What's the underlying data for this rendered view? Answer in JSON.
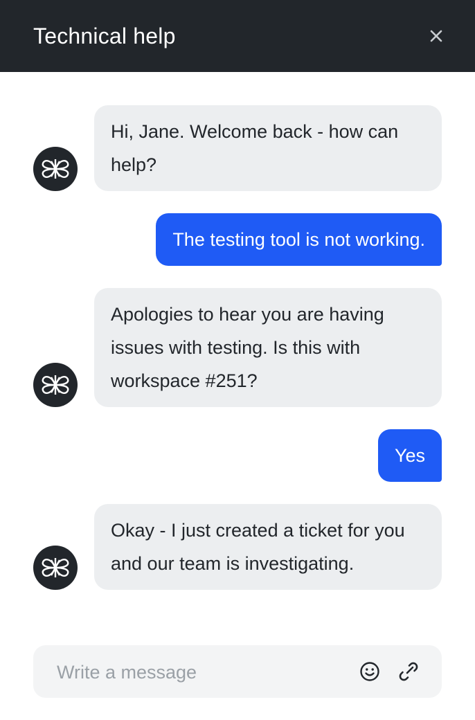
{
  "header": {
    "title": "Technical help",
    "close_icon": "close-icon"
  },
  "bot_avatar_icon": "bot-logo-icon",
  "messages": [
    {
      "sender": "bot",
      "text": "Hi, Jane. Welcome back - how can help?"
    },
    {
      "sender": "user",
      "text": "The testing tool is not working."
    },
    {
      "sender": "bot",
      "text": "Apologies to hear you are having issues with testing. Is this with workspace #251?"
    },
    {
      "sender": "user",
      "text": "Yes"
    },
    {
      "sender": "bot",
      "text": "Okay - I just created a ticket for you and our team is investigating."
    }
  ],
  "composer": {
    "placeholder": "Write a message",
    "emoji_icon": "emoji-icon",
    "attach_icon": "attach-icon"
  },
  "colors": {
    "header_bg": "#22262b",
    "user_bubble": "#1f5bf5",
    "bot_bubble": "#eceef0",
    "composer_bg": "#f3f4f5"
  }
}
